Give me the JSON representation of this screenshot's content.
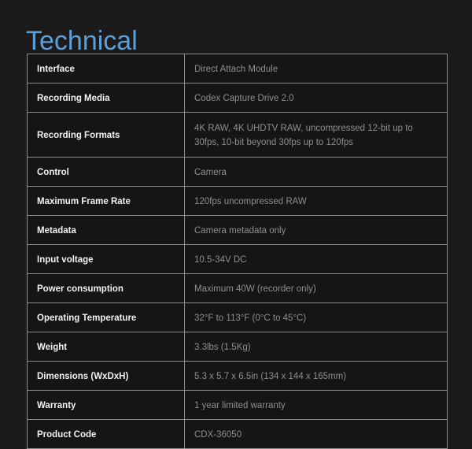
{
  "page": {
    "title": "Technical",
    "title_color": "#5e9fd8",
    "background_color": "#1b1b1b",
    "table_border_color": "#8c8c8c",
    "cell_background_color": "#151515",
    "label_color": "#f2f2f2",
    "value_color": "#8e8e8e"
  },
  "spec_table": {
    "rows": [
      {
        "label": "Interface",
        "value": "Direct Attach Module"
      },
      {
        "label": "Recording Media",
        "value": "Codex Capture Drive 2.0"
      },
      {
        "label": "Recording Formats",
        "value": "4K RAW, 4K UHDTV RAW, uncompressed 12-bit up to 30fps, 10-bit beyond 30fps up to 120fps"
      },
      {
        "label": "Control",
        "value": "Camera"
      },
      {
        "label": "Maximum Frame Rate",
        "value": "120fps uncompressed RAW"
      },
      {
        "label": "Metadata",
        "value": "Camera metadata only"
      },
      {
        "label": "Input voltage",
        "value": "10.5-34V DC"
      },
      {
        "label": "Power consumption",
        "value": "Maximum 40W (recorder only)"
      },
      {
        "label": "Operating Temperature",
        "value": "32°F to 113°F (0°C to 45°C)"
      },
      {
        "label": "Weight",
        "value": "3.3lbs (1.5Kg)"
      },
      {
        "label": "Dimensions (WxDxH)",
        "value": "5.3 x 5.7 x 6.5in (134 x 144 x 165mm)"
      },
      {
        "label": "Warranty",
        "value": "1 year limited warranty"
      },
      {
        "label": "Product Code",
        "value": "CDX-36050"
      }
    ]
  }
}
